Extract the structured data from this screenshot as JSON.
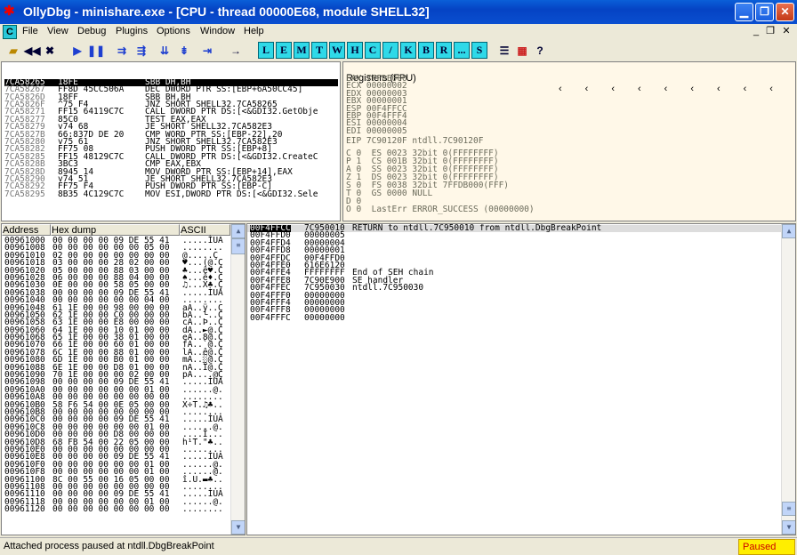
{
  "title": "OllyDbg - minishare.exe - [CPU - thread 00000E68, module SHELL32]",
  "menu": [
    "File",
    "View",
    "Debug",
    "Plugins",
    "Options",
    "Window",
    "Help"
  ],
  "toolbar_letters": [
    "L",
    "E",
    "M",
    "T",
    "W",
    "H",
    "C",
    "/",
    "K",
    "B",
    "R",
    "...",
    "S"
  ],
  "disasm": [
    [
      "7CA58265",
      "18FE",
      "SBB DH,BH"
    ],
    [
      "7CA58267",
      "FF8D 45CC506A",
      "DEC DWORD PTR SS:[EBP+6A50CC45]"
    ],
    [
      "7CA5826D",
      "18FF",
      "SBB BH,BH"
    ],
    [
      "7CA5826F",
      "^75 F4",
      "JNZ SHORT SHELL32.7CA58265"
    ],
    [
      "7CA58271",
      "FF15 64119C7C",
      "CALL DWORD PTR DS:[<&GDI32.GetObje"
    ],
    [
      "7CA58277",
      "85C0",
      "TEST EAX,EAX"
    ],
    [
      "7CA58279",
      "v74 68",
      "JE SHORT SHELL32.7CA582E3"
    ],
    [
      "7CA5827B",
      "66:837D DE 20",
      "CMP WORD PTR SS:[EBP-22],20"
    ],
    [
      "7CA58280",
      "v75 61",
      "JNZ SHORT SHELL32.7CA582E3"
    ],
    [
      "7CA58282",
      "FF75 08",
      "PUSH DWORD PTR SS:[EBP+8]"
    ],
    [
      "7CA58285",
      "FF15 48129C7C",
      "CALL DWORD PTR DS:[<&GDI32.CreateC"
    ],
    [
      "7CA5828B",
      "3BC3",
      "CMP EAX,EBX"
    ],
    [
      "7CA5828D",
      "8945 14",
      "MOV DWORD PTR SS:[EBP+14],EAX"
    ],
    [
      "7CA58290",
      "v74 51",
      "JE SHORT SHELL32.7CA582E3"
    ],
    [
      "7CA58292",
      "FF75 F4",
      "PUSH DWORD PTR SS:[EBP-C]"
    ],
    [
      "7CA58295",
      "8B35 4C129C7C",
      "MOV ESI,DWORD PTR DS:[<&GDI32.Sele"
    ]
  ],
  "registers_header": "Registers (FPU)",
  "regs": [
    "EAX 7FFDE000",
    "ECX 00000002",
    "EDX 00000003",
    "EBX 00000001",
    "ESP 00F4FFCC",
    "EBP 00F4FFF4",
    "ESI 00000004",
    "EDI 00000005"
  ],
  "eip": "EIP 7C90120F ntdll.7C90120F",
  "flags": [
    "C 0  ES 0023 32bit 0(FFFFFFFF)",
    "P 1  CS 001B 32bit 0(FFFFFFFF)",
    "A 0  SS 0023 32bit 0(FFFFFFFF)",
    "Z 1  DS 0023 32bit 0(FFFFFFFF)",
    "S 0  FS 0038 32bit 7FFDB000(FFF)",
    "T 0  GS 0000 NULL",
    "D 0",
    "O 0  LastErr ERROR_SUCCESS (00000000)"
  ],
  "dump_headers": [
    "Address",
    "Hex dump",
    "ASCII"
  ],
  "dump": [
    [
      "00961000",
      "00 00 00 00 09 DE 55 41",
      ".....ÌUA"
    ],
    [
      "00961008",
      "00 00 00 00 00 00 05 00",
      "........"
    ],
    [
      "00961010",
      "02 00 00 00 00 00 00 00",
      "@.....Ç"
    ],
    [
      "00961018",
      "03 00 00 00 28 02 00 00",
      "♥...(@.Ç"
    ],
    [
      "00961020",
      "05 00 00 00 88 03 00 00",
      "♣...ê♥.Ç"
    ],
    [
      "00961028",
      "06 00 00 00 88 04 00 00",
      "♠...ê♦.Ç"
    ],
    [
      "00961030",
      "0E 00 00 00 58 05 00 00",
      "♫...X♣.Ç"
    ],
    [
      "00961038",
      "00 00 00 00 09 DE 55 41",
      ".....ÌUA"
    ],
    [
      "00961040",
      "00 00 00 00 00 00 04 00",
      "........"
    ],
    [
      "00961048",
      "61 1E 00 00 98 00 00 00",
      "aA..ÿ..Ç"
    ],
    [
      "00961050",
      "62 1E 00 00 C0 00 00 00",
      "bA..└..Ç"
    ],
    [
      "00961058",
      "63 1E 00 00 E8 00 00 00",
      "cA..Þ..Ç"
    ],
    [
      "00961060",
      "64 1E 00 00 10 01 00 00",
      "dA..►@.Ç"
    ],
    [
      "00961068",
      "65 1E 00 00 38 01 00 00",
      "eA..8@.Ç"
    ],
    [
      "00961070",
      "66 1E 00 00 60 01 00 00",
      "fA..`@.Ç"
    ],
    [
      "00961078",
      "6C 1E 00 00 88 01 00 00",
      "lA..ê@.Ç"
    ],
    [
      "00961080",
      "6D 1E 00 00 B0 01 00 00",
      "mA..░@.Ç"
    ],
    [
      "00961088",
      "6E 1E 00 00 D8 01 00 00",
      "nA..Ï@.Ç"
    ],
    [
      "00961090",
      "70 1E 00 00 00 02 00 00",
      "pA....@Ç"
    ],
    [
      "00961098",
      "00 00 00 00 09 DE 55 41",
      ".....ÌUA"
    ],
    [
      "009610A0",
      "00 00 00 00 00 00 01 00",
      "......@."
    ],
    [
      "009610A8",
      "00 00 00 00 00 00 00 00",
      "........"
    ],
    [
      "009610B0",
      "58 F6 54 00 0E 05 00 00",
      "X÷T.♫♣.."
    ],
    [
      "009610B8",
      "00 00 00 00 00 00 00 00",
      "........"
    ],
    [
      "009610C0",
      "00 00 00 00 09 DE 55 41",
      ".....ÌUA"
    ],
    [
      "009610C8",
      "00 00 00 00 00 00 01 00",
      "......@."
    ],
    [
      "009610D0",
      "00 00 00 00 D8 00 00 00",
      "....Ï..."
    ],
    [
      "009610D8",
      "68 FB 54 00 22 05 00 00",
      "h¹T.\"♣.."
    ],
    [
      "009610E0",
      "00 00 00 00 00 00 00 00",
      "........"
    ],
    [
      "009610E8",
      "00 00 00 00 09 DE 55 41",
      ".....ÌUA"
    ],
    [
      "009610F0",
      "00 00 00 00 00 00 01 00",
      "......@."
    ],
    [
      "009610F8",
      "00 00 00 00 00 00 01 00",
      "......@."
    ],
    [
      "00961100",
      "8C 00 55 00 16 05 00 00",
      "î.U.▬♣.."
    ],
    [
      "00961108",
      "00 00 00 00 00 00 00 00",
      "........"
    ],
    [
      "00961110",
      "00 00 00 00 09 DE 55 41",
      ".....ÌUA"
    ],
    [
      "00961118",
      "00 00 00 00 00 00 01 00",
      "......@."
    ],
    [
      "00961120",
      "00 00 00 00 00 00 00 00",
      "........"
    ]
  ],
  "stack": [
    [
      "00F4FFCC",
      "7C950010",
      "RETURN to ntdll.7C950010 from ntdll.DbgBreakPoint"
    ],
    [
      "00F4FFD0",
      "00000005",
      ""
    ],
    [
      "00F4FFD4",
      "00000004",
      ""
    ],
    [
      "00F4FFD8",
      "00000001",
      ""
    ],
    [
      "00F4FFDC",
      "00F4FFD0",
      ""
    ],
    [
      "00F4FFE0",
      "616E6120",
      ""
    ],
    [
      "00F4FFE4",
      "FFFFFFFF",
      "End of SEH chain"
    ],
    [
      "00F4FFE8",
      "7C90E900",
      "SE handler"
    ],
    [
      "00F4FFEC",
      "7C950030",
      "ntdll.7C950030"
    ],
    [
      "00F4FFF0",
      "00000000",
      ""
    ],
    [
      "00F4FFF4",
      "00000000",
      ""
    ],
    [
      "00F4FFF8",
      "00000000",
      ""
    ],
    [
      "00F4FFFC",
      "00000000",
      ""
    ]
  ],
  "status": "Attached process paused at ntdll.DbgBreakPoint",
  "state": "Paused"
}
